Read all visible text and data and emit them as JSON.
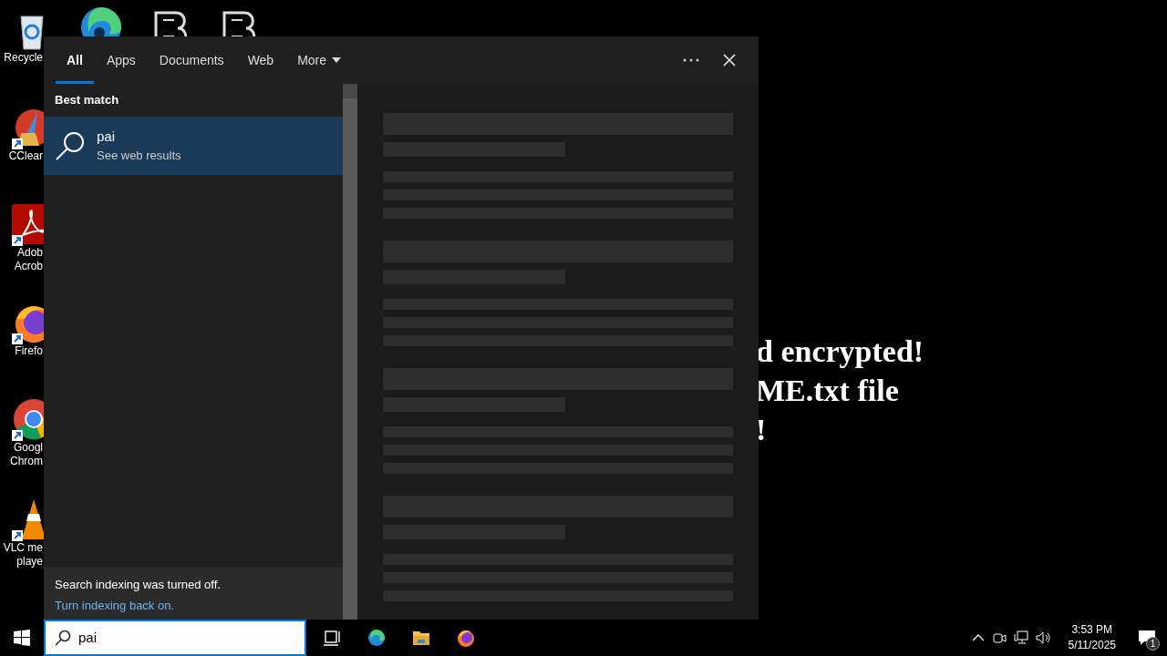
{
  "desktop": {
    "icons": [
      {
        "kind": "recycle",
        "lines": [
          "Recycle"
        ]
      },
      {
        "kind": "edge"
      },
      {
        "kind": "letter-b"
      },
      {
        "kind": "letter-b"
      },
      {
        "kind": "ccleaner",
        "lines": [
          "CClear"
        ]
      },
      {
        "kind": "acrobat",
        "lines": [
          "Adob",
          "Acrob"
        ]
      },
      {
        "kind": "firefox",
        "lines": [
          "Firefo"
        ]
      },
      {
        "kind": "chrome",
        "lines": [
          "Googl",
          "Chrom"
        ]
      },
      {
        "kind": "vlc",
        "lines": [
          "VLC me",
          "playe"
        ]
      }
    ],
    "wallpaper_lines": [
      "d encrypted!",
      "ME.txt file",
      "!"
    ]
  },
  "search_panel": {
    "tabs": [
      {
        "label": "All",
        "selected": true,
        "kind": "tab"
      },
      {
        "label": "Apps",
        "selected": false,
        "kind": "tab"
      },
      {
        "label": "Documents",
        "selected": false,
        "kind": "tab"
      },
      {
        "label": "Web",
        "selected": false,
        "kind": "tab"
      },
      {
        "label": "More",
        "selected": false,
        "kind": "dropdown"
      }
    ],
    "section_title": "Best match",
    "results": [
      {
        "title": "pai",
        "subtitle": "See web results",
        "selected": true
      }
    ],
    "indexing_notice": {
      "message": "Search indexing was turned off.",
      "link": "Turn indexing back on."
    }
  },
  "taskbar": {
    "search": {
      "value": "pai"
    },
    "clock": {
      "time": "3:53 PM",
      "date": "5/11/2025"
    },
    "notification_count": "1"
  }
}
